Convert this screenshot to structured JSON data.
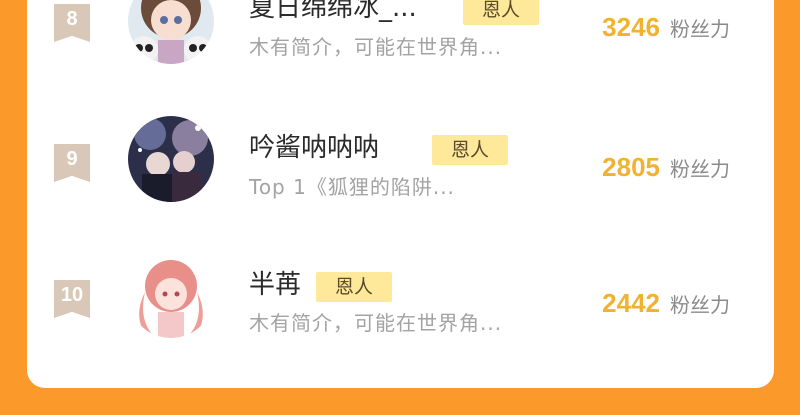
{
  "rows": [
    {
      "rank": "8",
      "name": "夏日绵绵冰_...",
      "badge": "恩人",
      "bio": "木有简介，可能在世界角...",
      "fans": "3246",
      "fans_unit": "粉丝力",
      "avatar_icon": "anime-girl-panda-avatar"
    },
    {
      "rank": "9",
      "name": "吟酱呐呐呐",
      "badge": "恩人",
      "bio": "Top 1《狐狸的陷阱...",
      "fans": "2805",
      "fans_unit": "粉丝力",
      "avatar_icon": "dark-night-scene-avatar"
    },
    {
      "rank": "10",
      "name": "半苒",
      "badge": "恩人",
      "bio": "木有简介，可能在世界角...",
      "fans": "2442",
      "fans_unit": "粉丝力",
      "avatar_icon": "pink-hair-girl-avatar"
    }
  ],
  "colors": {
    "background": "#fb9a2a",
    "card": "#ffffff",
    "fans_number": "#f1b232",
    "badge_bg": "#fde999",
    "rank_bg": "#d9c8b8"
  }
}
